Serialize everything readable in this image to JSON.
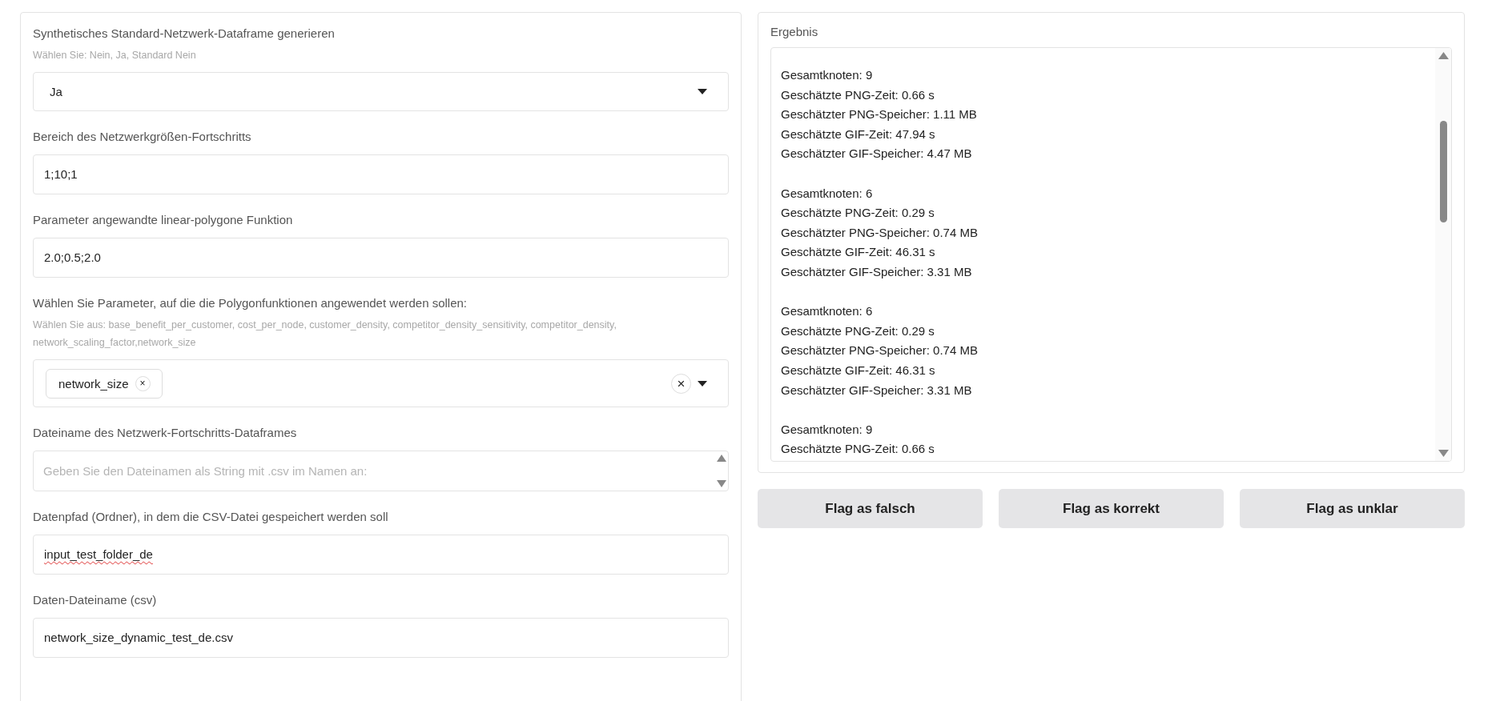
{
  "form": {
    "fields": [
      {
        "kind": "dropdown",
        "label": "Synthetisches Standard-Netzwerk-Dataframe generieren",
        "hint": "Wählen Sie: Nein, Ja, Standard Nein",
        "value": "Ja"
      },
      {
        "kind": "text",
        "label": "Bereich des Netzwerkgrößen-Fortschritts",
        "value": "1;10;1"
      },
      {
        "kind": "text",
        "label": "Parameter angewandte linear-polygone Funktion",
        "value": "2.0;0.5;2.0"
      },
      {
        "kind": "multiselect",
        "label": "Wählen Sie Parameter, auf die die Polygonfunktionen angewendet werden sollen:",
        "hint": "Wählen Sie aus: base_benefit_per_customer, cost_per_node, customer_density, competitor_density_sensitivity, competitor_density, network_scaling_factor,network_size",
        "tags": [
          "network_size"
        ],
        "clear": "×",
        "remove": "×"
      },
      {
        "kind": "textarea",
        "label": "Dateiname des Netzwerk-Fortschritts-Dataframes",
        "placeholder": "Geben Sie den Dateinamen als String mit .csv im Namen an:"
      },
      {
        "kind": "text",
        "label": "Datenpfad (Ordner), in dem die CSV-Datei gespeichert werden soll",
        "value": "input_test_folder_de",
        "misspelled": true
      },
      {
        "kind": "text",
        "label": "Daten-Dateiname (csv)",
        "value": "network_size_dynamic_test_de.csv"
      }
    ]
  },
  "result": {
    "label": "Ergebnis",
    "groups": [
      {
        "lines": [
          "Gesamtknoten: 9",
          "Geschätzte PNG-Zeit: 0.66 s",
          "Geschätzter PNG-Speicher: 1.11 MB",
          "Geschätzte GIF-Zeit: 47.94 s",
          "Geschätzter GIF-Speicher: 4.47 MB"
        ]
      },
      {
        "lines": [
          "Gesamtknoten: 6",
          "Geschätzte PNG-Zeit: 0.29 s",
          "Geschätzter PNG-Speicher: 0.74 MB",
          "Geschätzte GIF-Zeit: 46.31 s",
          "Geschätzter GIF-Speicher: 3.31 MB"
        ]
      },
      {
        "lines": [
          "Gesamtknoten: 6",
          "Geschätzte PNG-Zeit: 0.29 s",
          "Geschätzter PNG-Speicher: 0.74 MB",
          "Geschätzte GIF-Zeit: 46.31 s",
          "Geschätzter GIF-Speicher: 3.31 MB"
        ]
      },
      {
        "lines": [
          "Gesamtknoten: 9",
          "Geschätzte PNG-Zeit: 0.66 s"
        ]
      }
    ]
  },
  "buttons": [
    "Flag as falsch",
    "Flag as korrekt",
    "Flag as unklar"
  ]
}
